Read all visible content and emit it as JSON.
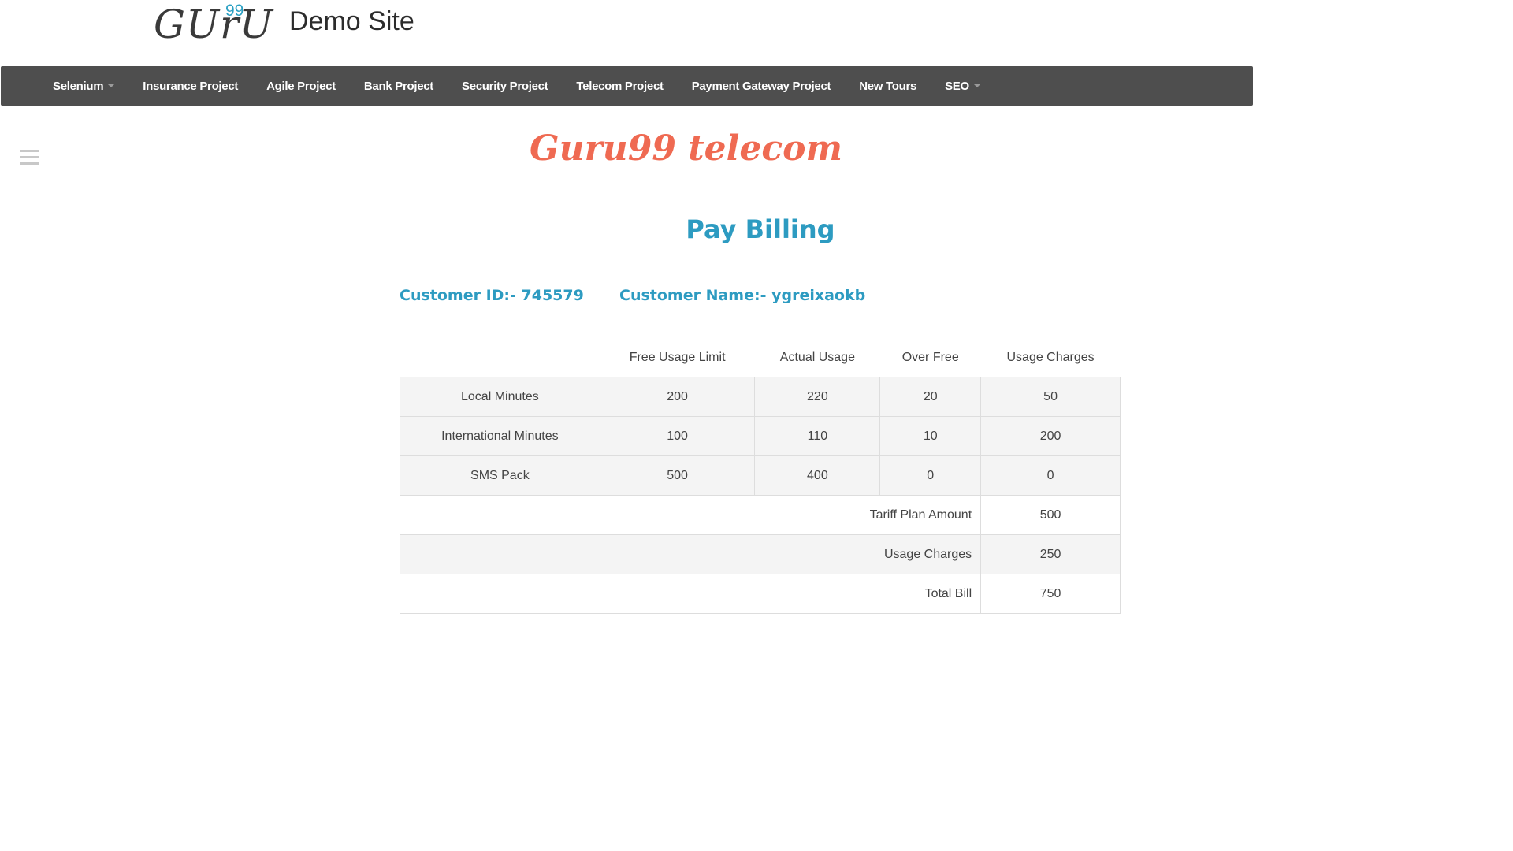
{
  "header": {
    "logo_text": "GUrU",
    "logo_sup": "99",
    "site_title": "Demo Site"
  },
  "nav": [
    {
      "label": "Selenium",
      "dropdown": true
    },
    {
      "label": "Insurance Project",
      "dropdown": false
    },
    {
      "label": "Agile Project",
      "dropdown": false
    },
    {
      "label": "Bank Project",
      "dropdown": false
    },
    {
      "label": "Security Project",
      "dropdown": false
    },
    {
      "label": "Telecom Project",
      "dropdown": false
    },
    {
      "label": "Payment Gateway Project",
      "dropdown": false
    },
    {
      "label": "New Tours",
      "dropdown": false
    },
    {
      "label": "SEO",
      "dropdown": true
    }
  ],
  "brand": "Guru99 telecom",
  "heading": "Pay Billing",
  "customer": {
    "id_label": "Customer ID:- 745579",
    "name_label": "Customer Name:- ygreixaokb"
  },
  "table": {
    "headers": [
      "",
      "Free Usage Limit",
      "Actual Usage",
      "Over Free",
      "Usage Charges"
    ],
    "rows": [
      [
        "Local Minutes",
        "200",
        "220",
        "20",
        "50"
      ],
      [
        "International Minutes",
        "100",
        "110",
        "10",
        "200"
      ],
      [
        "SMS Pack",
        "500",
        "400",
        "0",
        "0"
      ]
    ],
    "summary": [
      {
        "label": "Tariff Plan Amount",
        "value": "500"
      },
      {
        "label": "Usage Charges",
        "value": "250"
      },
      {
        "label": "Total Bill",
        "value": "750"
      }
    ]
  },
  "colors": {
    "accent": "#2d9bc1",
    "brand": "#ef6a52",
    "navbar": "#4e4e4e"
  },
  "icons": [
    "menu-icon",
    "caret-down-icon"
  ]
}
